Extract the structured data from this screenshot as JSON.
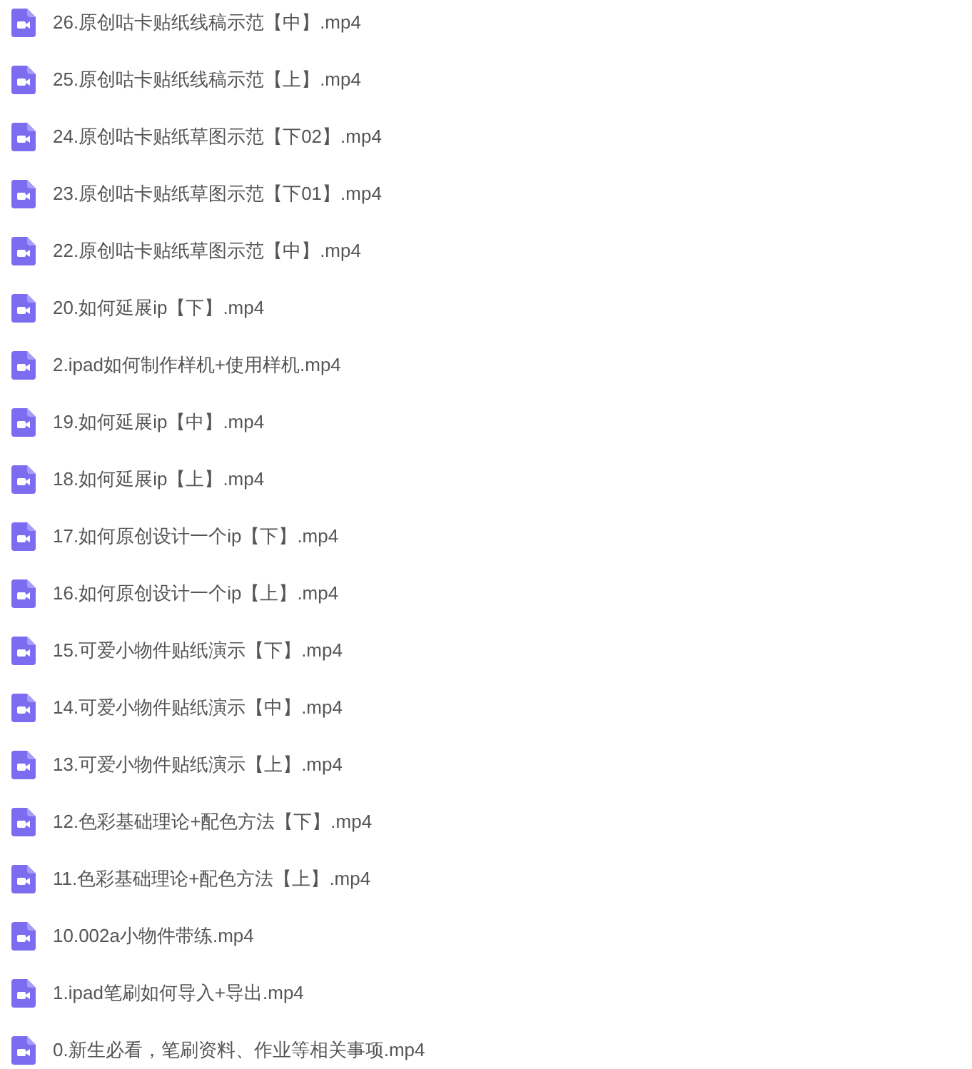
{
  "files": [
    {
      "name": "26.原创咕卡贴纸线稿示范【中】.mp4"
    },
    {
      "name": "25.原创咕卡贴纸线稿示范【上】.mp4"
    },
    {
      "name": "24.原创咕卡贴纸草图示范【下02】.mp4"
    },
    {
      "name": "23.原创咕卡贴纸草图示范【下01】.mp4"
    },
    {
      "name": "22.原创咕卡贴纸草图示范【中】.mp4"
    },
    {
      "name": "20.如何延展ip【下】.mp4"
    },
    {
      "name": "2.ipad如何制作样机+使用样机.mp4"
    },
    {
      "name": "19.如何延展ip【中】.mp4"
    },
    {
      "name": "18.如何延展ip【上】.mp4"
    },
    {
      "name": "17.如何原创设计一个ip【下】.mp4"
    },
    {
      "name": "16.如何原创设计一个ip【上】.mp4"
    },
    {
      "name": "15.可爱小物件贴纸演示【下】.mp4"
    },
    {
      "name": "14.可爱小物件贴纸演示【中】.mp4"
    },
    {
      "name": "13.可爱小物件贴纸演示【上】.mp4"
    },
    {
      "name": "12.色彩基础理论+配色方法【下】.mp4"
    },
    {
      "name": "11.色彩基础理论+配色方法【上】.mp4"
    },
    {
      "name": "10.002a小物件带练.mp4"
    },
    {
      "name": "1.ipad笔刷如何导入+导出.mp4"
    },
    {
      "name": "0.新生必看，笔刷资料、作业等相关事项.mp4"
    }
  ]
}
